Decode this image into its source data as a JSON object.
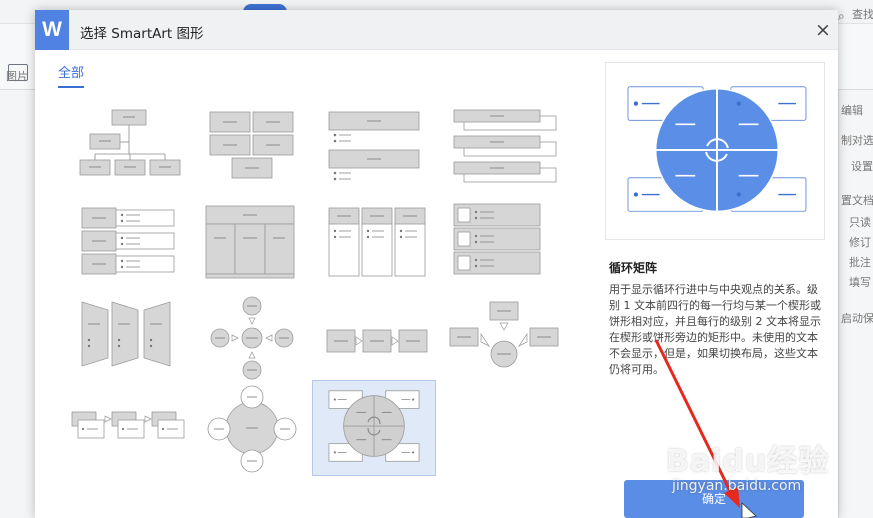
{
  "background": {
    "search_label": "查找",
    "picture_label": "图片",
    "right_panel_items": [
      "字",
      "编辑",
      "制对选",
      "设置",
      "置文档",
      "只读",
      "修订",
      "批注",
      "填写",
      "启动保"
    ]
  },
  "dialog": {
    "app_logo": "W",
    "title": "选择 SmartArt 图形",
    "close_label": "×",
    "tab_all": "全部",
    "preview": {
      "name": "循环矩阵",
      "description": "用于显示循环行进中与中央观点的关系。级别 1 文本前四行的每一行均与某一个楔形或饼形相对应，并且每行的级别 2 文本将显示在楔形或饼形旁边的矩形中。未使用的文本不会显示，但是，如果切换布局，这些文本仍将可用。"
    },
    "ok_label": "确定"
  },
  "watermark": {
    "brand": "Baidu经验",
    "url": "jingyan.baidu.com"
  },
  "colors": {
    "accent": "#4f82e3",
    "preview_circle": "#5b8ee7",
    "annotation_arrow": "#e8281d",
    "thumb_gray": "#d6d6d6"
  }
}
